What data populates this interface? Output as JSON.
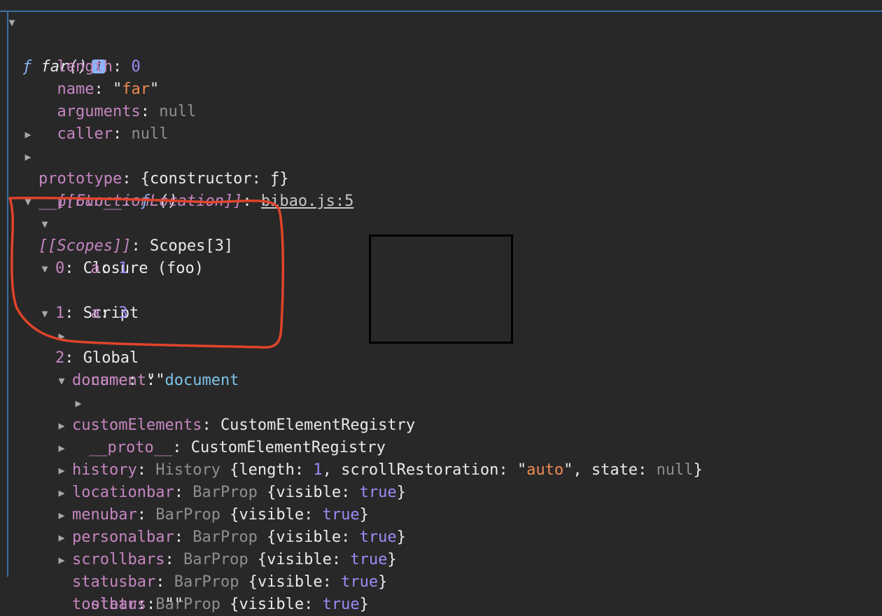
{
  "header": {
    "f": "ƒ",
    "name": "far()",
    "info": "i"
  },
  "props": {
    "length": {
      "key": "length",
      "value": "0"
    },
    "name": {
      "key": "name",
      "value": "far"
    },
    "arguments": {
      "key": "arguments",
      "value": "null"
    },
    "caller": {
      "key": "caller",
      "value": "null"
    },
    "prototype": {
      "key": "prototype",
      "value": "{constructor: ƒ}"
    },
    "proto": {
      "key": "__proto__",
      "f": "ƒ",
      "value": "()"
    },
    "location": {
      "key": "[[FunctionLocation]]",
      "value": "bibao.js:5"
    },
    "scopes": {
      "key": "[[Scopes]]",
      "value": "Scopes[3]"
    }
  },
  "scopes": [
    {
      "index": "0",
      "label": "Closure (foo)",
      "var_key": "a",
      "var_value": "1"
    },
    {
      "index": "1",
      "label": "Script",
      "var_key": "a",
      "var_value": "3"
    },
    {
      "index": "2",
      "label": "Global"
    }
  ],
  "global": {
    "document": {
      "key": "document",
      "value": "document"
    },
    "name": {
      "key": "name",
      "value": "\"\""
    },
    "customElements": {
      "key": "customElements",
      "value": "CustomElementRegistry"
    },
    "ceProto": {
      "key": "__proto__",
      "value": "CustomElementRegistry"
    },
    "history": {
      "key": "history",
      "cls": "History",
      "p1": "length",
      "v1": "1",
      "p2": "scrollRestoration",
      "v2": "auto",
      "p3": "state",
      "v3": "null"
    },
    "bars": [
      {
        "key": "locationbar",
        "cls": "BarProp",
        "p": "visible",
        "v": "true"
      },
      {
        "key": "menubar",
        "cls": "BarProp",
        "p": "visible",
        "v": "true"
      },
      {
        "key": "personalbar",
        "cls": "BarProp",
        "p": "visible",
        "v": "true"
      },
      {
        "key": "scrollbars",
        "cls": "BarProp",
        "p": "visible",
        "v": "true"
      },
      {
        "key": "statusbar",
        "cls": "BarProp",
        "p": "visible",
        "v": "true"
      },
      {
        "key": "toolbar",
        "cls": "BarProp",
        "p": "visible",
        "v": "true"
      }
    ]
  },
  "colors": {
    "background": "#282828",
    "key": "#c586c0",
    "number": "#9c8cf6",
    "string": "#f28b54",
    "annotation": "#e0442c"
  }
}
